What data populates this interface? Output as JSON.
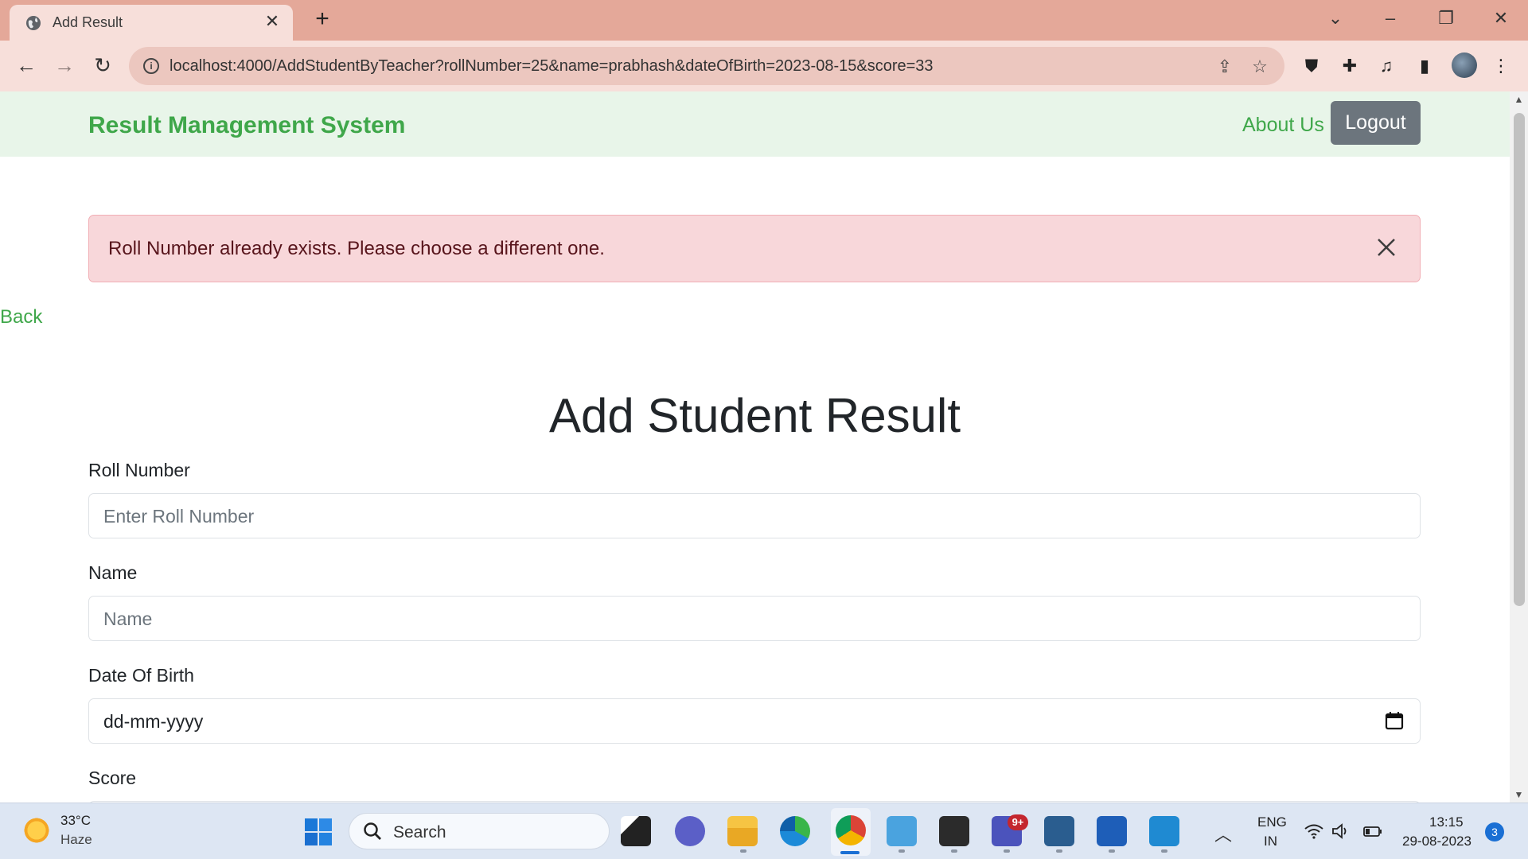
{
  "browser": {
    "tab_title": "Add Result",
    "url": "localhost:4000/AddStudentByTeacher?rollNumber=25&name=prabhash&dateOfBirth=2023-08-15&score=33"
  },
  "navbar": {
    "brand": "Result Management System",
    "about_label": "About Us",
    "logout_label": "Logout"
  },
  "alert": {
    "message": "Roll Number already exists. Please choose a different one."
  },
  "back_label": "Back",
  "form": {
    "heading": "Add Student Result",
    "roll": {
      "label": "Roll Number",
      "placeholder": "Enter Roll Number"
    },
    "name": {
      "label": "Name",
      "placeholder": "Name"
    },
    "dob": {
      "label": "Date Of Birth",
      "value": "dd-mm-yyyy"
    },
    "score": {
      "label": "Score"
    }
  },
  "taskbar": {
    "weather_temp": "33°C",
    "weather_desc": "Haze",
    "search_label": "Search",
    "teams_badge": "9+",
    "lang_line1": "ENG",
    "lang_line2": "IN",
    "time": "13:15",
    "date": "29-08-2023",
    "notification_count": "3"
  },
  "colors": {
    "brand_green": "#3fa74a",
    "navbar_bg": "#e8f5e9",
    "alert_bg": "#f8d7da",
    "logout_bg": "#6c757d",
    "titlebar_bg": "#e4a899"
  }
}
